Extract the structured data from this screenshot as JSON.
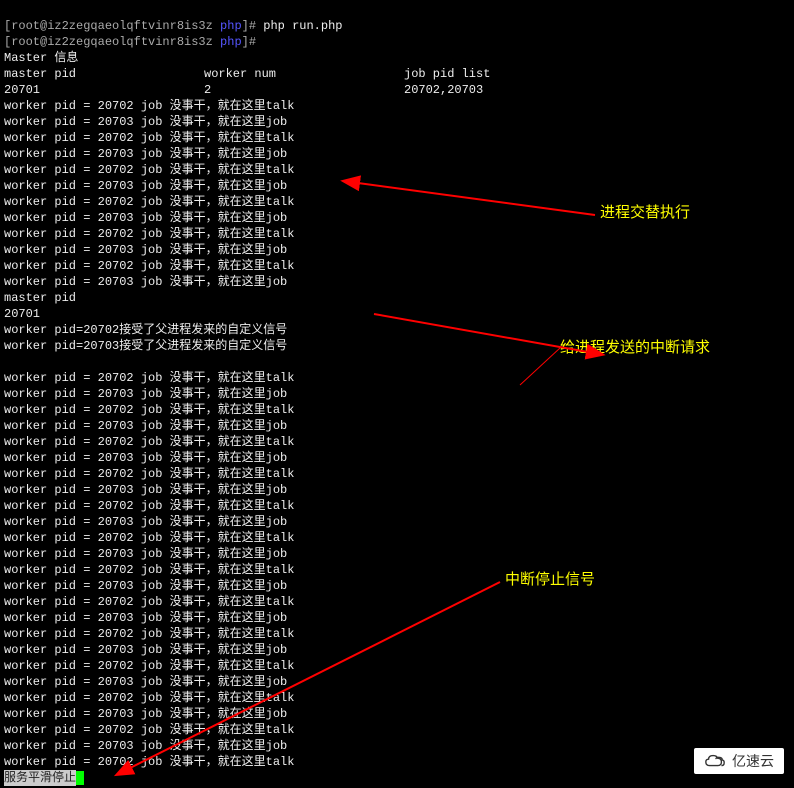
{
  "prompt": {
    "user_host": "[root@iz2zegqaeolqftvinr8is3z ",
    "folder": "php",
    "suffix": "]# "
  },
  "commands": [
    "php run.php",
    ""
  ],
  "master_info_header": "Master 信息",
  "header_cols": {
    "col1": "master pid",
    "col2": "worker num",
    "col3": "job pid list"
  },
  "header_vals": {
    "col1": "20701",
    "col2": "2",
    "col3": "20702,20703"
  },
  "worker_lines_block1": [
    {
      "pid": "20702",
      "task": "talk"
    },
    {
      "pid": "20703",
      "task": "job"
    },
    {
      "pid": "20702",
      "task": "talk"
    },
    {
      "pid": "20703",
      "task": "job"
    },
    {
      "pid": "20702",
      "task": "talk"
    },
    {
      "pid": "20703",
      "task": "job"
    },
    {
      "pid": "20702",
      "task": "talk"
    },
    {
      "pid": "20703",
      "task": "job"
    },
    {
      "pid": "20702",
      "task": "talk"
    },
    {
      "pid": "20703",
      "task": "job"
    },
    {
      "pid": "20702",
      "task": "talk"
    },
    {
      "pid": "20703",
      "task": "job"
    }
  ],
  "master_pid_label": "master pid",
  "master_pid_val": "20701",
  "signal_lines": [
    {
      "pid": "20702",
      "text": "接受了父进程发来的自定义信号"
    },
    {
      "pid": "20703",
      "text": "接受了父进程发来的自定义信号"
    }
  ],
  "worker_lines_block2": [
    {
      "pid": "20702",
      "task": "talk"
    },
    {
      "pid": "20703",
      "task": "job"
    },
    {
      "pid": "20702",
      "task": "talk"
    },
    {
      "pid": "20703",
      "task": "job"
    },
    {
      "pid": "20702",
      "task": "talk"
    },
    {
      "pid": "20703",
      "task": "job"
    },
    {
      "pid": "20702",
      "task": "talk"
    },
    {
      "pid": "20703",
      "task": "job"
    },
    {
      "pid": "20702",
      "task": "talk"
    },
    {
      "pid": "20703",
      "task": "job"
    },
    {
      "pid": "20702",
      "task": "talk"
    },
    {
      "pid": "20703",
      "task": "job"
    },
    {
      "pid": "20702",
      "task": "talk"
    },
    {
      "pid": "20703",
      "task": "job"
    },
    {
      "pid": "20702",
      "task": "talk"
    },
    {
      "pid": "20703",
      "task": "job"
    },
    {
      "pid": "20702",
      "task": "talk"
    },
    {
      "pid": "20703",
      "task": "job"
    },
    {
      "pid": "20702",
      "task": "talk"
    },
    {
      "pid": "20703",
      "task": "job"
    },
    {
      "pid": "20702",
      "task": "talk"
    },
    {
      "pid": "20703",
      "task": "job"
    },
    {
      "pid": "20702",
      "task": "talk"
    },
    {
      "pid": "20703",
      "task": "job"
    },
    {
      "pid": "20702",
      "task": "talk"
    }
  ],
  "worker_line_prefix": "worker pid = ",
  "worker_line_mid": " job 没事干，就在这里",
  "signal_line_prefix": "worker pid=",
  "final_line": "服务平滑停止",
  "annotations": {
    "ann1": "进程交替执行",
    "ann2": "给进程发送的中断请求",
    "ann3": "中断停止信号"
  },
  "watermark": "亿速云"
}
